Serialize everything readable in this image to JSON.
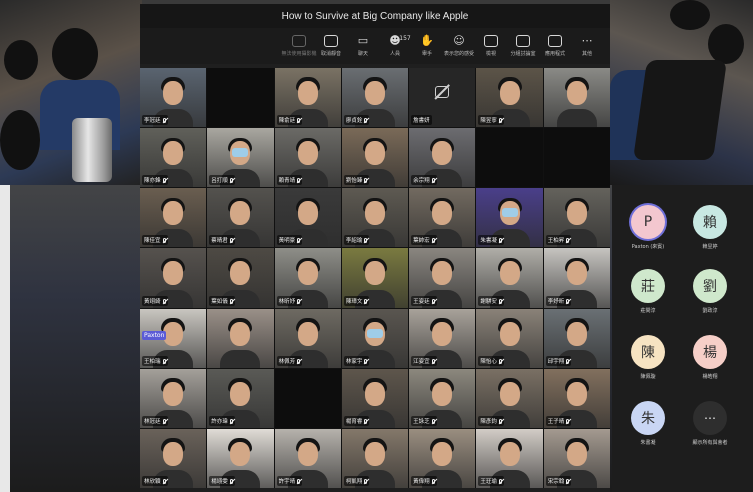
{
  "window": {
    "title": "How to Survive at Big Company like Apple"
  },
  "toolbar": {
    "items": [
      {
        "icon": "camera-off-icon",
        "label": "無法使用攝影機",
        "dim": true
      },
      {
        "icon": "mic-off-icon",
        "label": "取消靜音",
        "dim": false
      },
      {
        "icon": "chat-icon",
        "label": "聊天",
        "dim": false
      },
      {
        "icon": "people-icon",
        "label": "人員",
        "count": "157",
        "dim": false
      },
      {
        "icon": "hand-icon",
        "label": "舉手",
        "dim": false
      },
      {
        "icon": "reactions-icon",
        "label": "表示您的感受",
        "dim": false
      },
      {
        "icon": "view-icon",
        "label": "檢視",
        "dim": false
      },
      {
        "icon": "rooms-icon",
        "label": "分組討論室",
        "dim": false
      },
      {
        "icon": "apps-icon",
        "label": "應用程式",
        "dim": false
      },
      {
        "icon": "more-icon",
        "label": "其他",
        "dim": false
      }
    ]
  },
  "tiles": [
    {
      "name": "李冠廷",
      "type": "video",
      "bg": "#5a6470"
    },
    {
      "name": "",
      "type": "blank"
    },
    {
      "name": "陳俞廷",
      "type": "video",
      "bg": "#7a7264"
    },
    {
      "name": "廖貞銓",
      "type": "video",
      "bg": "#6a6e72"
    },
    {
      "name": "詹書妍",
      "type": "camoff"
    },
    {
      "name": "陳昱寧",
      "type": "video",
      "bg": "#5c5448"
    },
    {
      "name": "",
      "type": "video",
      "bg": "#8a8a86"
    },
    {
      "name": "陳亦鋒",
      "type": "video",
      "bg": "#60605a"
    },
    {
      "name": "呂打順",
      "type": "video",
      "bg": "#a9a7a0",
      "mask": true
    },
    {
      "name": "賴青靖",
      "type": "video",
      "bg": "#6b6a66"
    },
    {
      "name": "劉怡臻",
      "type": "video",
      "bg": "#7a6a58"
    },
    {
      "name": "余宗翔",
      "type": "video",
      "bg": "#6c6c70"
    },
    {
      "name": "",
      "type": "blank"
    },
    {
      "name": "",
      "type": "blank"
    },
    {
      "name": "陳佳宜",
      "type": "video",
      "bg": "#6a5e50"
    },
    {
      "name": "蔡晴君",
      "type": "video",
      "bg": "#54524e"
    },
    {
      "name": "黃明豪",
      "type": "video",
      "bg": "#3a3a3a"
    },
    {
      "name": "李紹瑜",
      "type": "video",
      "bg": "#5e5a52"
    },
    {
      "name": "葉帥宏",
      "type": "video",
      "bg": "#726a60"
    },
    {
      "name": "朱書凝",
      "type": "video",
      "bg": "#4a3f8a",
      "mask": true
    },
    {
      "name": "王柏昇",
      "type": "video",
      "bg": "#64625c"
    },
    {
      "name": "黃翊綺",
      "type": "video",
      "bg": "#56524e"
    },
    {
      "name": "葉如儀",
      "type": "video",
      "bg": "#4e4a44"
    },
    {
      "name": "林昕妤",
      "type": "video",
      "bg": "#8e8e88"
    },
    {
      "name": "陳璋文",
      "type": "video",
      "bg": "#7a7a40"
    },
    {
      "name": "王姿廷",
      "type": "video",
      "bg": "#8a8680"
    },
    {
      "name": "謝騏安",
      "type": "video",
      "bg": "#b0aea8"
    },
    {
      "name": "李妤昕",
      "type": "video",
      "bg": "#c6c4c0"
    },
    {
      "name": "王柏瑞",
      "type": "video",
      "bg": "#c9c6c0",
      "highlight": "Paxton"
    },
    {
      "name": "",
      "type": "video",
      "bg": "#9a9088"
    },
    {
      "name": "林佩芳",
      "type": "video",
      "bg": "#6e6a62"
    },
    {
      "name": "林家宇",
      "type": "video",
      "bg": "#5a5650",
      "mask": true
    },
    {
      "name": "江姿宜",
      "type": "video",
      "bg": "#a8a29a"
    },
    {
      "name": "陳怡心",
      "type": "video",
      "bg": "#8a8278"
    },
    {
      "name": "邱宇翔",
      "type": "video",
      "bg": "#6a7074"
    },
    {
      "name": "林冠廷",
      "type": "video",
      "bg": "#a4a09a"
    },
    {
      "name": "許亦瑋",
      "type": "video",
      "bg": "#5a5a56"
    },
    {
      "name": "",
      "type": "blank"
    },
    {
      "name": "楊育睿",
      "type": "video",
      "bg": "#5e564c"
    },
    {
      "name": "王詠芝",
      "type": "video",
      "bg": "#8c887e"
    },
    {
      "name": "陳彥鈞",
      "type": "video",
      "bg": "#7a7064"
    },
    {
      "name": "王子晴",
      "type": "video",
      "bg": "#82705e"
    },
    {
      "name": "林欣穎",
      "type": "video",
      "bg": "#6a625a"
    },
    {
      "name": "楊翊雯",
      "type": "video",
      "bg": "#e0dcd6"
    },
    {
      "name": "許宇晴",
      "type": "video",
      "bg": "#b6b2ac"
    },
    {
      "name": "柯凱翔",
      "type": "video",
      "bg": "#84786a"
    },
    {
      "name": "黃偉翔",
      "type": "video",
      "bg": "#9a8e80"
    },
    {
      "name": "王玨瑜",
      "type": "video",
      "bg": "#d2ccc6"
    },
    {
      "name": "宋宗翰",
      "type": "video",
      "bg": "#a49a90"
    }
  ],
  "panel": {
    "participants": [
      {
        "initial": "P",
        "name": "Paxton (來賓)",
        "color": "#f3c7cf",
        "selected": true
      },
      {
        "initial": "賴",
        "name": "賴昱婷",
        "color": "#c8e8e2"
      },
      {
        "initial": "莊",
        "name": "莊閔淳",
        "color": "#cfe8cc"
      },
      {
        "initial": "劉",
        "name": "劉政淳",
        "color": "#cfe8cc"
      },
      {
        "initial": "陳",
        "name": "陳佩璇",
        "color": "#f6e3c2"
      },
      {
        "initial": "楊",
        "name": "楊皓翔",
        "color": "#f6cfc8"
      },
      {
        "initial": "朱",
        "name": "朱書凝",
        "color": "#c9d6f4"
      }
    ],
    "more": {
      "label": "顯示所有與會者",
      "icon": "more-dots-icon"
    }
  },
  "colors": {
    "accent": "#6f6fd8",
    "highlight": "#5b5bd6"
  }
}
